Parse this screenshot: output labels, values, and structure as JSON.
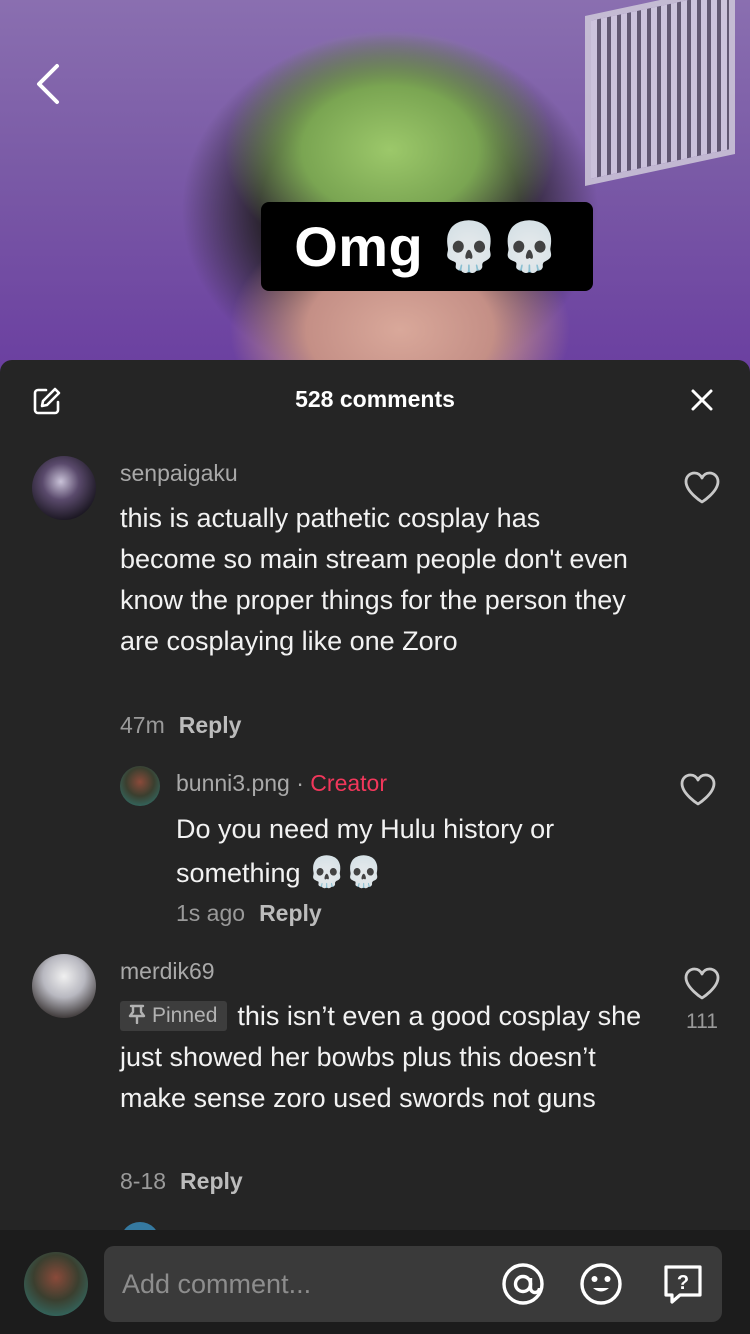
{
  "video": {
    "caption_text": "Omg",
    "caption_emoji": "💀💀"
  },
  "sheet": {
    "title": "528 comments"
  },
  "comments": [
    {
      "username": "senpaigaku",
      "text": "this is actually pathetic cosplay has become so main stream people don't even know the proper things for the person they are cosplaying like one Zoro",
      "time": "47m",
      "reply_label": "Reply"
    },
    {
      "username": "bunni3.png",
      "separator": " · ",
      "creator_label": "Creator",
      "text": "Do you need my Hulu history or something ",
      "text_emoji": "💀💀",
      "time": "1s ago",
      "reply_label": "Reply"
    },
    {
      "username": "merdik69",
      "pinned_label": "Pinned",
      "text": "this isn’t even a good cosplay she just showed her bowbs plus this doesn’t make sense zoro used swords not guns",
      "time": "8-18",
      "reply_label": "Reply",
      "likes": "111"
    }
  ],
  "composer": {
    "placeholder": "Add comment..."
  },
  "icons": {
    "back": "chevron-left-icon",
    "edit": "edit-icon",
    "close": "close-icon",
    "like": "heart-icon",
    "pin": "pin-icon",
    "mention": "at-icon",
    "emoji": "emoji-icon",
    "question": "question-icon"
  },
  "colors": {
    "sheet_bg": "#252525",
    "creator": "#f2375b",
    "composer_bg": "#1c1c1c"
  }
}
